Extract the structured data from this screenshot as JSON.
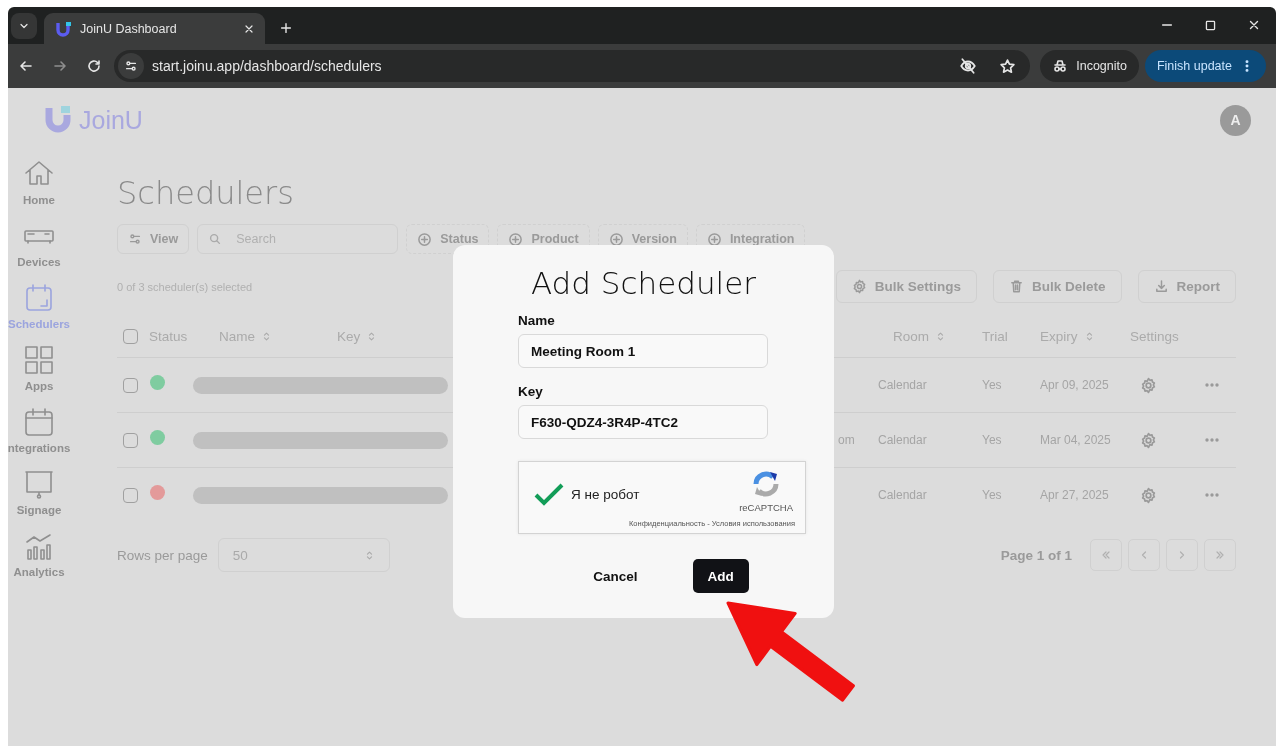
{
  "browser": {
    "tabs": [
      {
        "title": "JoinU Dashboard",
        "selected": true
      }
    ],
    "url": "start.joinu.app/dashboard/schedulers",
    "incognito": "Incognito",
    "update_button": "Finish update"
  },
  "app": {
    "logo": "JoinU",
    "avatar": "A",
    "sidebar": {
      "items": [
        {
          "label": "Home",
          "kind": "home",
          "selected": false
        },
        {
          "label": "Devices",
          "kind": "devices",
          "selected": false
        },
        {
          "label": "Schedulers",
          "kind": "schedulers",
          "selected": true
        },
        {
          "label": "Apps",
          "kind": "apps",
          "selected": false
        },
        {
          "label": "ntegrations",
          "kind": "integrations",
          "selected": false
        },
        {
          "label": "Signage",
          "kind": "signage",
          "selected": false
        },
        {
          "label": "Analytics",
          "kind": "analytics",
          "selected": false
        }
      ]
    },
    "page_title": "Schedulers",
    "toolbar": {
      "view_button": "View",
      "search": {
        "placeholder": "Search"
      },
      "filters": [
        "Status",
        "Product",
        "Version",
        "Integration"
      ]
    },
    "selection_text": "0 of 3 scheduler(s) selected",
    "actions": [
      {
        "label": "Bulk Settings",
        "kind": "gear"
      },
      {
        "label": "Bulk Delete",
        "kind": "trash"
      },
      {
        "label": "Report",
        "kind": "download"
      }
    ],
    "table": {
      "select_all": {
        "checked": false
      },
      "columns": [
        {
          "label": "Status",
          "sortable": false
        },
        {
          "label": "Name",
          "sortable": true
        },
        {
          "label": "Key",
          "sortable": true
        },
        {
          "label": "Room",
          "sortable": true
        },
        {
          "label": "Trial",
          "sortable": false
        },
        {
          "label": "Expiry",
          "sortable": true
        },
        {
          "label": "Settings",
          "sortable": false
        }
      ],
      "rows": [
        {
          "checked": false,
          "color": "#7fcca0",
          "room": "Calendar",
          "trial": "Yes",
          "expiry": "Apr 09, 2025"
        },
        {
          "checked": false,
          "color": "#7fcca0",
          "column_5": "om",
          "room": "Calendar",
          "trial": "Yes",
          "expiry": "Mar 04, 2025"
        },
        {
          "checked": false,
          "color": "#e39a9a",
          "room": "Calendar",
          "trial": "Yes",
          "expiry": "Apr 27, 2025"
        }
      ]
    },
    "pagination": {
      "rows_per_page_label": "Rows per page",
      "rows_per_page": "50",
      "page_label": "Page 1 of 1"
    }
  },
  "dialog": {
    "title": "Add Scheduler",
    "fields": [
      {
        "label": "Name",
        "value": "Meeting Room 1"
      },
      {
        "label": "Key",
        "value": "F630-QDZ4-3R4P-4TC2"
      }
    ],
    "captcha": {
      "label": "Я не робот",
      "checked": true,
      "brand": "reCAPTCHA",
      "links": "Конфиденциальность - Условия использования"
    },
    "buttons": [
      {
        "label": "Cancel",
        "kind": "text"
      },
      {
        "label": "Add",
        "kind": "primary"
      }
    ]
  }
}
